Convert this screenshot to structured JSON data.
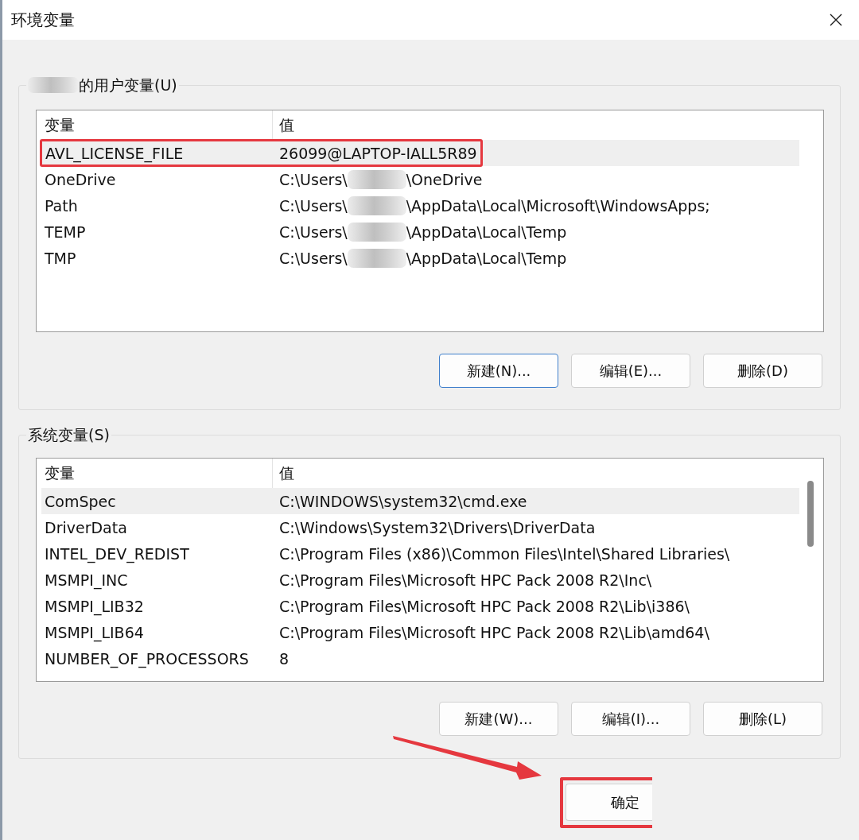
{
  "window": {
    "title": "环境变量"
  },
  "user_variables": {
    "label": "的用户变量(U)",
    "label_redacted": true,
    "columns": [
      "变量",
      "值"
    ],
    "rows": [
      {
        "name": "AVL_LICENSE_FILE",
        "value": "26099@LAPTOP-IALL5R89",
        "redacted": false,
        "selected": true,
        "marked": true
      },
      {
        "name": "OneDrive",
        "value": "C:\\Users\\",
        "redacted": true,
        "value_end": "\\OneDrive",
        "selected": false,
        "marked": false
      },
      {
        "name": "Path",
        "value": "C:\\Users\\",
        "redacted": true,
        "value_end": "\\AppData\\Local\\Microsoft\\WindowsApps;",
        "selected": false,
        "marked": false
      },
      {
        "name": "TEMP",
        "value": "C:\\Users\\",
        "redacted": true,
        "value_end": "\\AppData\\Local\\Temp",
        "selected": false,
        "marked": false
      },
      {
        "name": "TMP",
        "value": "C:\\Users\\",
        "redacted": true,
        "value_end": "\\AppData\\Local\\Temp",
        "selected": false,
        "marked": false
      }
    ],
    "buttons": [
      {
        "label": "新建(N)...",
        "focused": true
      },
      {
        "label": "编辑(E)...",
        "focused": false
      },
      {
        "label": "删除(D)",
        "focused": false
      }
    ]
  },
  "system_variables": {
    "label": "系统变量(S)",
    "scrollbar": true,
    "columns": [
      "变量",
      "值"
    ],
    "rows": [
      {
        "name": "ComSpec",
        "value": "C:\\WINDOWS\\system32\\cmd.exe",
        "selected": true
      },
      {
        "name": "DriverData",
        "value": "C:\\Windows\\System32\\Drivers\\DriverData",
        "selected": false
      },
      {
        "name": "INTEL_DEV_REDIST",
        "value": "C:\\Program Files (x86)\\Common Files\\Intel\\Shared Libraries\\",
        "selected": false
      },
      {
        "name": "MSMPI_INC",
        "value": "C:\\Program Files\\Microsoft HPC Pack 2008 R2\\Inc\\",
        "selected": false
      },
      {
        "name": "MSMPI_LIB32",
        "value": "C:\\Program Files\\Microsoft HPC Pack 2008 R2\\Lib\\i386\\",
        "selected": false
      },
      {
        "name": "MSMPI_LIB64",
        "value": "C:\\Program Files\\Microsoft HPC Pack 2008 R2\\Lib\\amd64\\",
        "selected": false
      },
      {
        "name": "NUMBER_OF_PROCESSORS",
        "value": "8",
        "selected": false
      }
    ],
    "buttons": [
      {
        "label": "新建(W)...",
        "focused": false
      },
      {
        "label": "编辑(I)...",
        "focused": false
      },
      {
        "label": "删除(L)",
        "focused": false
      }
    ]
  },
  "footer": {
    "ok_button": {
      "label": "确定",
      "marked": true
    }
  }
}
